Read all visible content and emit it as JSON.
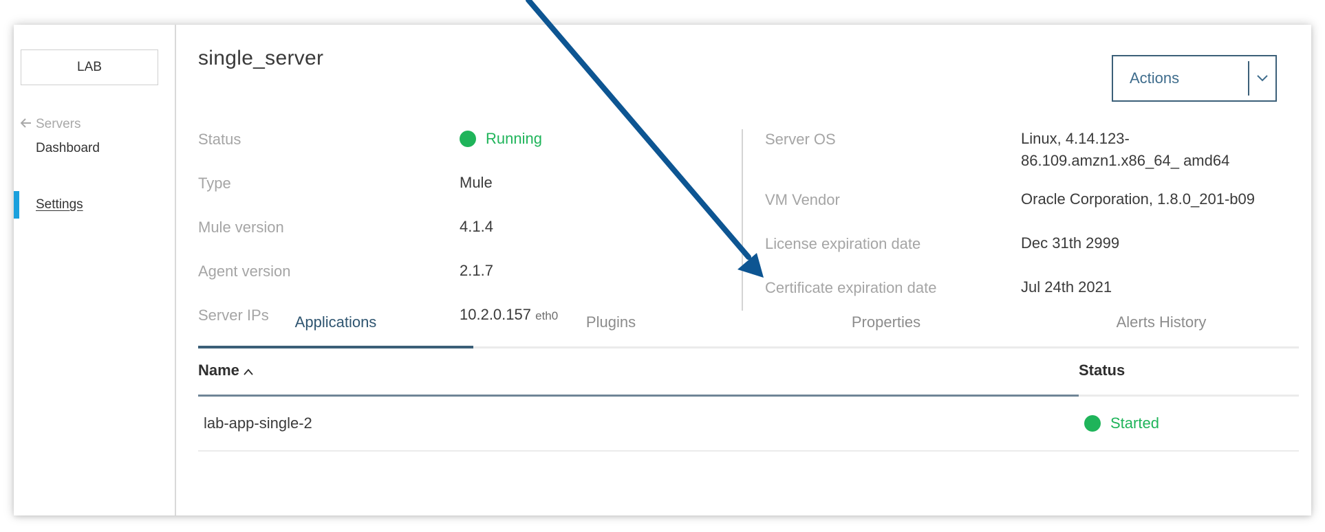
{
  "sidebar": {
    "environment": "LAB",
    "back_label": "Servers",
    "back_icon": "left-arrow-icon",
    "items": [
      {
        "label": "Dashboard",
        "active": false
      },
      {
        "label": "Settings",
        "active": true
      }
    ],
    "accent_color": "#1aa0dd"
  },
  "header": {
    "title": "single_server",
    "actions_label": "Actions",
    "actions_icon": "chevron-down-icon"
  },
  "details_left": [
    {
      "label": "Status",
      "value": "Running"
    },
    {
      "label": "Type",
      "value": "Mule"
    },
    {
      "label": "Mule version",
      "value": "4.1.4"
    },
    {
      "label": "Agent version",
      "value": "2.1.7"
    },
    {
      "label": "Server IPs",
      "value": "10.2.0.157",
      "value_suffix": "eth0"
    }
  ],
  "details_right": [
    {
      "label": "Server OS",
      "value_line1": "Linux, 4.14.123-",
      "value_line2": "86.109.amzn1.x86_64_ amd64"
    },
    {
      "label": "VM Vendor",
      "value": "Oracle Corporation, 1.8.0_201-b09"
    },
    {
      "label": "License expiration date",
      "value": "Dec 31th 2999"
    },
    {
      "label": "Certificate expiration date",
      "value": "Jul 24th 2021"
    }
  ],
  "tabs": [
    {
      "label": "Applications",
      "active": true
    },
    {
      "label": "Plugins",
      "active": false
    },
    {
      "label": "Properties",
      "active": false
    },
    {
      "label": "Alerts History",
      "active": false
    }
  ],
  "table": {
    "columns": [
      {
        "label": "Name",
        "sort_icon": "sort-ascending-icon"
      },
      {
        "label": "Status"
      }
    ],
    "rows": [
      {
        "name": "lab-app-single-2",
        "status": "Started"
      }
    ]
  },
  "colors": {
    "status_green": "#1fb45a",
    "primary_blue": "#3b5f78",
    "annotation_arrow": "#0d5592"
  }
}
